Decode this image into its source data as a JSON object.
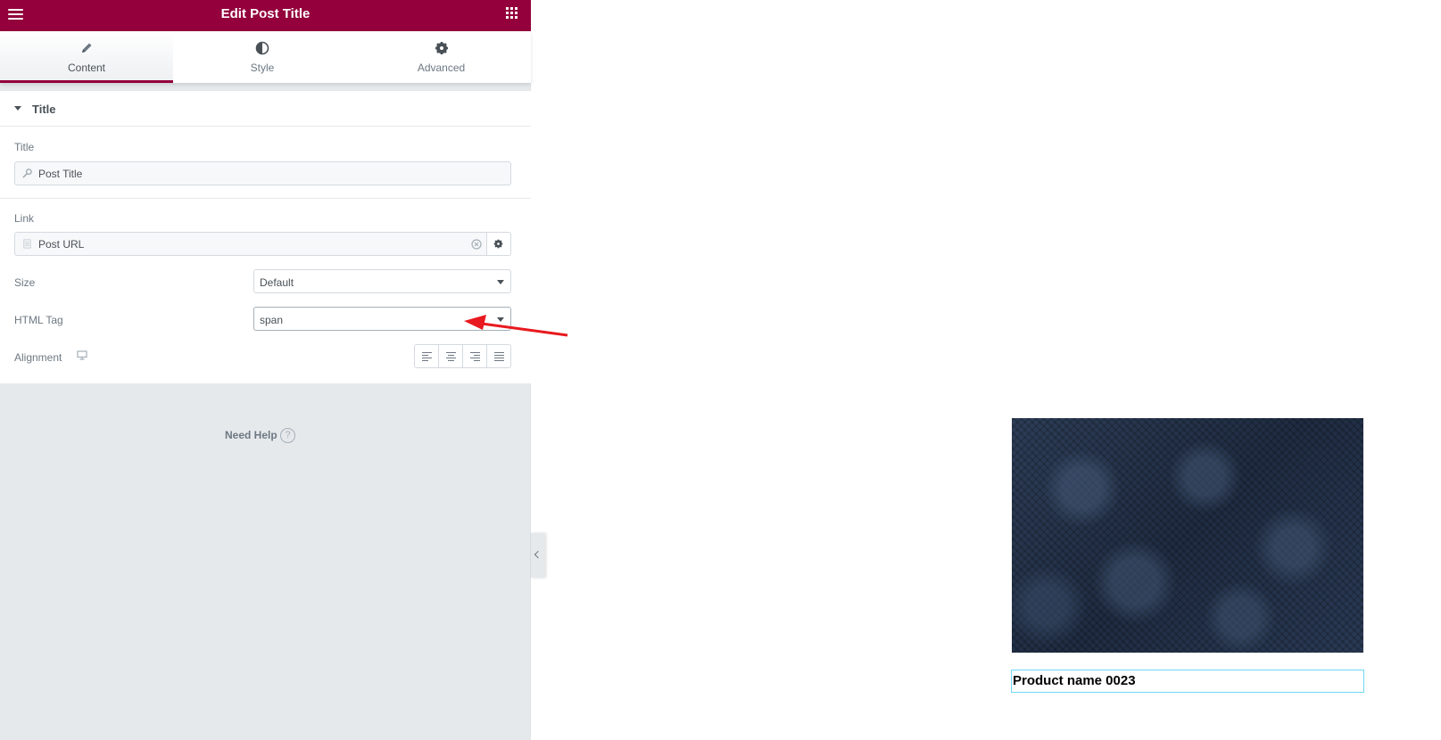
{
  "header": {
    "title": "Edit Post Title"
  },
  "tabs": [
    {
      "label": "Content",
      "icon": "pencil-icon",
      "active": true
    },
    {
      "label": "Style",
      "icon": "half-circle-icon",
      "active": false
    },
    {
      "label": "Advanced",
      "icon": "gear-icon",
      "active": false
    }
  ],
  "section": {
    "title": "Title"
  },
  "controls": {
    "title_label": "Title",
    "title_value": "Post Title",
    "link_label": "Link",
    "link_value": "Post URL",
    "size_label": "Size",
    "size_value": "Default",
    "html_tag_label": "HTML Tag",
    "html_tag_value": "span",
    "alignment_label": "Alignment"
  },
  "help": {
    "label": "Need Help",
    "icon_text": "?"
  },
  "preview": {
    "product_title": "Product name 0023"
  },
  "colors": {
    "accent": "#93003c",
    "annotation_arrow": "#e8191f",
    "selection_outline": "#71d7f7"
  }
}
